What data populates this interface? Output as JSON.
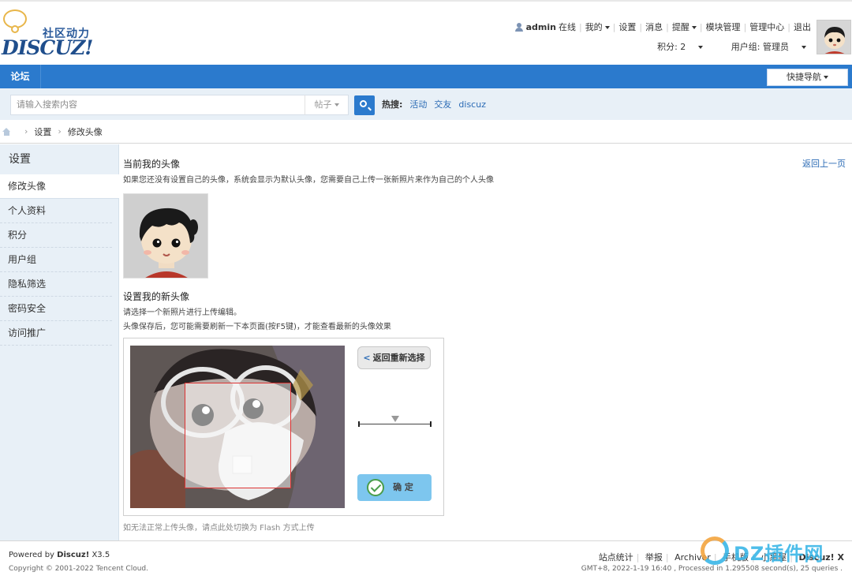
{
  "header": {
    "logo_cn": "社区动力",
    "logo_en": "DISCUZ!",
    "username": "admin",
    "online_label": "在线",
    "menu": [
      "我的",
      "设置",
      "消息",
      "提醒",
      "模块管理",
      "管理中心",
      "退出"
    ],
    "points": "积分: 2",
    "usergroup": "用户组: 管理员"
  },
  "nav": {
    "forum": "论坛",
    "quick_nav": "快捷导航"
  },
  "search": {
    "placeholder": "请输入搜索内容",
    "type": "帖子",
    "hot_label": "热搜:",
    "hot_keywords": [
      "活动",
      "交友",
      "discuz"
    ]
  },
  "breadcrumb": {
    "items": [
      "设置",
      "修改头像"
    ]
  },
  "sidebar": {
    "title": "设置",
    "items": [
      "修改头像",
      "个人资料",
      "积分",
      "用户组",
      "隐私筛选",
      "密码安全",
      "访问推广"
    ],
    "active_index": 0
  },
  "main": {
    "current_title": "当前我的头像",
    "current_desc": "如果您还没有设置自己的头像，系统会显示为默认头像，您需要自己上传一张新照片来作为自己的个人头像",
    "back_link": "返回上一页",
    "new_title": "设置我的新头像",
    "new_desc1": "请选择一个新照片进行上传编辑。",
    "new_desc2": "头像保存后，您可能需要刷新一下本页面(按F5键)，才能查看最新的头像效果",
    "editor": {
      "reselect": "返回重新选择",
      "confirm": "确 定",
      "zoom_level": 0.5
    },
    "flash_note": "如无法正常上传头像，请点此处切换为 Flash 方式上传"
  },
  "footer": {
    "powered_prefix": "Powered by",
    "powered_brand": "Discuz!",
    "powered_version": "X3.5",
    "copyright": "Copyright © 2001-2022 Tencent Cloud.",
    "links": [
      "站点统计",
      "举报",
      "Archiver",
      "手机版",
      "小黑屋",
      "Discuz! X"
    ],
    "stats": "GMT+8, 2022-1-19 16:40 , Processed in 1.295508 second(s), 25 queries ."
  },
  "watermark": {
    "text": "DZ插件网"
  },
  "colors": {
    "nav_blue": "#2b7acd",
    "link_blue": "#2b6bb5",
    "side_bg": "#e8f0f7",
    "confirm_bg": "#7dc6ee"
  }
}
